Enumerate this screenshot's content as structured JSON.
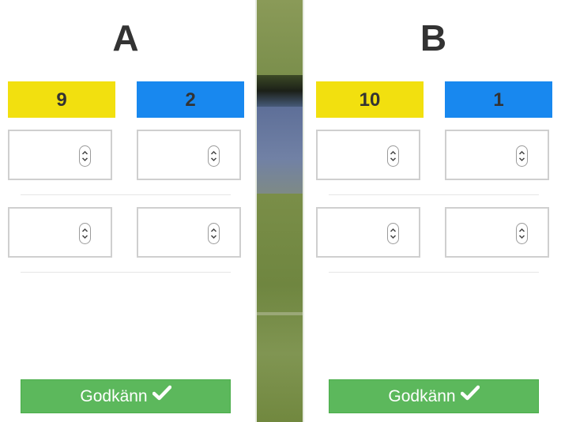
{
  "teams": [
    {
      "name": "A",
      "scores": {
        "yellow": "9",
        "blue": "2"
      },
      "approve_label": "Godkänn"
    },
    {
      "name": "B",
      "scores": {
        "yellow": "10",
        "blue": "1"
      },
      "approve_label": "Godkänn"
    }
  ],
  "colors": {
    "yellow": "#f2e00f",
    "blue": "#1888ef",
    "approve": "#5cb85c"
  },
  "icons": {
    "spinner": "up-down-spinner-icon",
    "approve": "checkmark-icon"
  }
}
